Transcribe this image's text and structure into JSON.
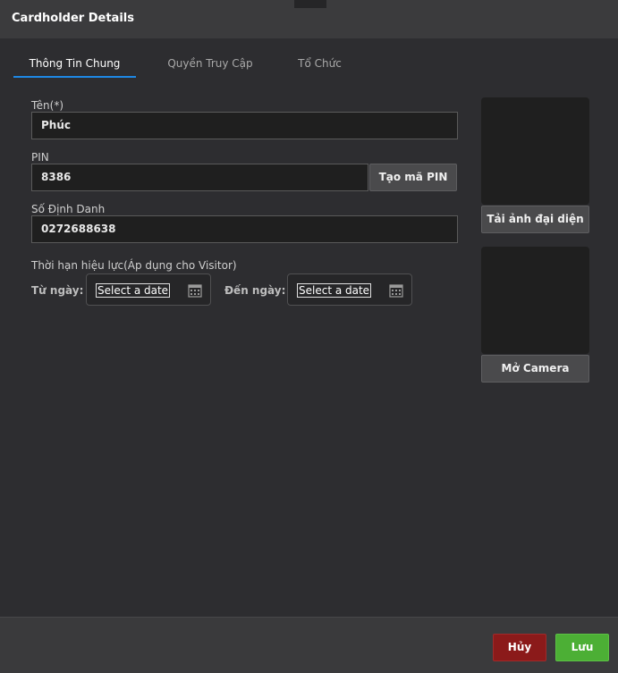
{
  "window": {
    "title": "Cardholder Details"
  },
  "tabs": [
    {
      "label": "Thông Tin Chung",
      "active": true
    },
    {
      "label": "Quyền Truy Cập",
      "active": false
    },
    {
      "label": "Tổ Chức",
      "active": false
    }
  ],
  "form": {
    "name_label": "Tên(*)",
    "name_value": "Phúc",
    "pin_label": "PIN",
    "pin_value": "8386",
    "generate_pin_label": "Tạo mã PIN",
    "id_label": "Số Định Danh",
    "id_value": "0272688638",
    "validity_label": "Thời hạn hiệu lực(Áp dụng cho Visitor)",
    "from_label": "Từ ngày:",
    "from_placeholder": "Select a date",
    "to_label": "Đến ngày:",
    "to_placeholder": "Select a date"
  },
  "photo": {
    "upload_label": "Tải ảnh đại diện",
    "camera_label": "Mở Camera"
  },
  "footer": {
    "cancel_label": "Hủy",
    "save_label": "Lưu"
  },
  "colors": {
    "accent": "#1e88e5",
    "cancel": "#8b1a1a",
    "save": "#4caf35"
  },
  "icons": [
    "calendar-icon"
  ]
}
